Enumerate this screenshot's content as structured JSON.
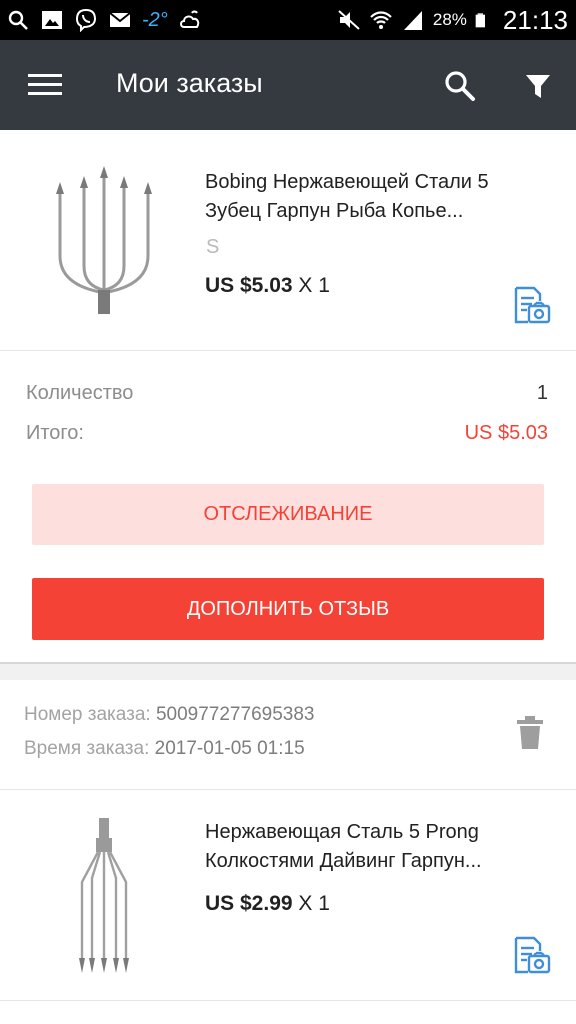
{
  "status_bar": {
    "temperature": "-2°",
    "battery": "28%",
    "time": "21:13"
  },
  "app_bar": {
    "title": "Мои заказы"
  },
  "order1": {
    "product": {
      "title_line1": "Bobing Нержавеющей Стали 5",
      "title_line2": "Зубец Гарпун Рыба Копье...",
      "variant": "S",
      "price": "US $5.03",
      "qty": "X 1"
    },
    "summary": {
      "quantity_label": "Количество",
      "quantity_value": "1",
      "total_label": "Итого:",
      "total_value": "US $5.03"
    },
    "track_button": "ОТСЛЕЖИВАНИЕ",
    "review_button": "ДОПОЛНИТЬ ОТЗЫВ"
  },
  "order2": {
    "order_number_label": "Номер заказа:",
    "order_number": "500977277695383",
    "order_time_label": "Время заказа:",
    "order_time": "2017-01-05 01:15",
    "product": {
      "title_line1": "Нержавеющая Сталь 5 Prong",
      "title_line2": "Колкостями Дайвинг Гарпун...",
      "price": "US $2.99",
      "qty": "X 1"
    }
  },
  "colors": {
    "accent": "#f44336",
    "accent_light": "#fde0de",
    "app_bar": "#343a40",
    "review_icon": "#3f8fd8",
    "temperature": "#37b4ff"
  },
  "icons": [
    "search-icon",
    "picture-icon",
    "viber-icon",
    "mail-icon",
    "weather-icon",
    "mute-icon",
    "wifi-icon",
    "signal-icon",
    "battery-icon",
    "menu-icon",
    "filter-icon",
    "review-photo-icon",
    "trash-icon"
  ]
}
